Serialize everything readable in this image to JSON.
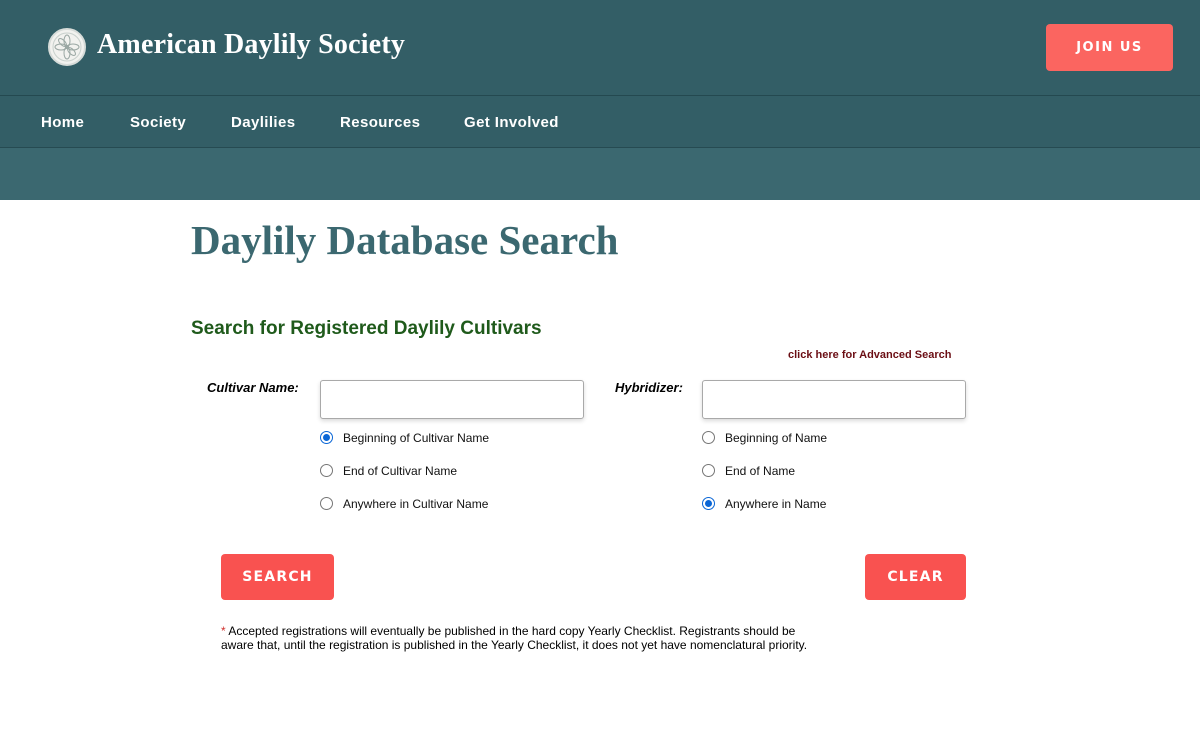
{
  "header": {
    "site_title": "American Daylily Society",
    "join_label": "JOIN US"
  },
  "nav": {
    "items": [
      "Home",
      "Society",
      "Daylilies",
      "Resources",
      "Get Involved"
    ]
  },
  "main": {
    "page_title": "Daylily Database Search",
    "section_title": "Search for Registered Daylily Cultivars",
    "advanced_link": "click here for Advanced Search",
    "cultivar": {
      "label": "Cultivar Name:",
      "value": "",
      "options": [
        {
          "label": "Beginning of Cultivar Name",
          "checked": true
        },
        {
          "label": "End of Cultivar Name",
          "checked": false
        },
        {
          "label": "Anywhere in Cultivar Name",
          "checked": false
        }
      ]
    },
    "hybridizer": {
      "label": "Hybridizer:",
      "value": "",
      "options": [
        {
          "label": "Beginning of Name",
          "checked": false
        },
        {
          "label": "End of Name",
          "checked": false
        },
        {
          "label": "Anywhere in Name",
          "checked": true
        }
      ]
    },
    "search_label": "SEARCH",
    "clear_label": "CLEAR",
    "footnote_marker": "*",
    "footnote_text": "Accepted registrations will eventually be published in the hard copy Yearly Checklist. Registrants should be aware that, until the registration is published in the Yearly Checklist, it does not yet have nomenclatural priority."
  },
  "colors": {
    "header_bg": "#335e66",
    "band_bg": "#3b6870",
    "accent_button": "#f95250",
    "title_text": "#3b6870",
    "section_title_text": "#1f5a1b",
    "link_text": "#6b0e14"
  },
  "icons": {
    "logo": "daylily-flower-seal-icon"
  }
}
